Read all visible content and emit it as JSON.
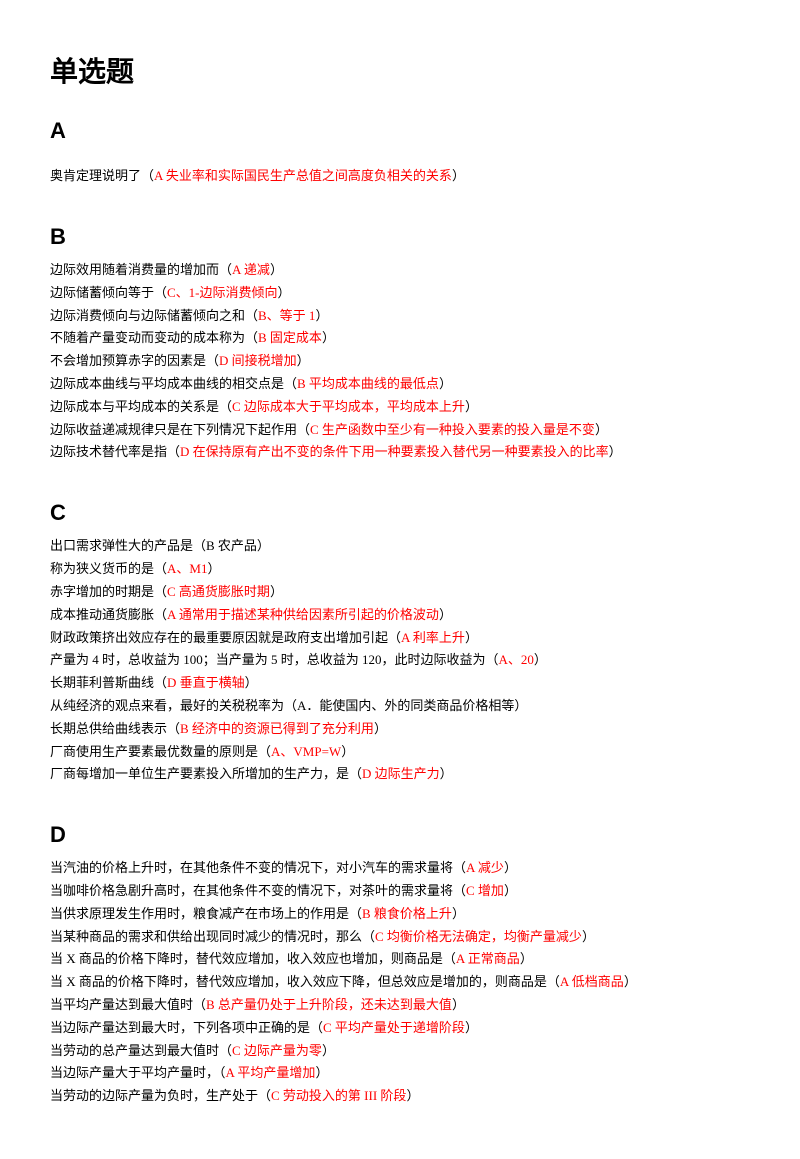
{
  "title": "单选题",
  "sections": {
    "A": {
      "heading": "A",
      "items": [
        {
          "pre": "奥肯定理说明了（",
          "ans": "A 失业率和实际国民生产总值之间高度负相关的关系",
          "post": "）"
        }
      ]
    },
    "B": {
      "heading": "B",
      "items": [
        {
          "pre": "边际效用随着消费量的增加而（",
          "ans": "A 递减",
          "post": "）"
        },
        {
          "pre": "边际储蓄倾向等于（",
          "ans": "C、1-边际消费倾向",
          "post": "）"
        },
        {
          "pre": "边际消费倾向与边际储蓄倾向之和（",
          "ans": "B、等于 1",
          "post": "）"
        },
        {
          "pre": "不随着产量变动而变动的成本称为（",
          "ans": "B 固定成本",
          "post": "）"
        },
        {
          "pre": "不会增加预算赤字的因素是（",
          "ans": "D 间接税增加",
          "post": "）"
        },
        {
          "pre": "边际成本曲线与平均成本曲线的相交点是（",
          "ans": "B 平均成本曲线的最低点",
          "post": "）"
        },
        {
          "pre": "边际成本与平均成本的关系是（",
          "ans": "C 边际成本大于平均成本，平均成本上升",
          "post": "）"
        },
        {
          "pre": "边际收益递减规律只是在下列情况下起作用（",
          "ans": "C 生产函数中至少有一种投入要素的投入量是不变",
          "post": "）"
        },
        {
          "pre": "边际技术替代率是指（",
          "ans": "D 在保持原有产出不变的条件下用一种要素投入替代另一种要素投入的比率",
          "post": "）"
        }
      ]
    },
    "C": {
      "heading": "C",
      "items": [
        {
          "pre": "出口需求弹性大的产品是（B 农产品）",
          "ans": "",
          "post": ""
        },
        {
          "pre": "称为狭义货币的是（",
          "ans": "A、M1",
          "post": "）"
        },
        {
          "pre": "赤字增加的时期是（",
          "ans": "C 高通货膨胀时期",
          "post": "）"
        },
        {
          "pre": "成本推动通货膨胀（",
          "ans": "A 通常用于描述某种供给因素所引起的价格波动",
          "post": "）"
        },
        {
          "pre": "财政政策挤出效应存在的最重要原因就是政府支出增加引起（",
          "ans": "A 利率上升",
          "post": "）"
        },
        {
          "pre": "产量为 4 时，总收益为 100；当产量为 5 时，总收益为 120，此时边际收益为（",
          "ans": "A、20",
          "post": "）"
        },
        {
          "pre": "长期菲利普斯曲线（",
          "ans": "D 垂直于横轴",
          "post": "）"
        },
        {
          "pre": "从纯经济的观点来看，最好的关税税率为（A．能使国内、外的同类商品价格相等）",
          "ans": "",
          "post": ""
        },
        {
          "pre": "长期总供给曲线表示（",
          "ans": "B 经济中的资源已得到了充分利用",
          "post": "）"
        },
        {
          "pre": "厂商使用生产要素最优数量的原则是（",
          "ans": "A、VMP=W",
          "post": "）"
        },
        {
          "pre": "厂商每增加一单位生产要素投入所增加的生产力，是（",
          "ans": "D 边际生产力",
          "post": "）"
        }
      ]
    },
    "D": {
      "heading": "D",
      "items": [
        {
          "pre": "当汽油的价格上升时，在其他条件不变的情况下，对小汽车的需求量将（",
          "ans": "A 减少",
          "post": "）"
        },
        {
          "pre": "当咖啡价格急剧升高时，在其他条件不变的情况下，对茶叶的需求量将（",
          "ans": "C 增加",
          "post": "）"
        },
        {
          "pre": "当供求原理发生作用时，粮食减产在市场上的作用是（",
          "ans": "B 粮食价格上升",
          "post": "）"
        },
        {
          "pre": "当某种商品的需求和供给出现同时减少的情况时，那么（",
          "ans": "C 均衡价格无法确定，均衡产量减少",
          "post": "）"
        },
        {
          "pre": "当 X 商品的价格下降时，替代效应增加，收入效应也增加，则商品是（",
          "ans": "A 正常商品",
          "post": "）"
        },
        {
          "pre": "当 X 商品的价格下降时，替代效应增加，收入效应下降，但总效应是增加的，则商品是（",
          "ans": "A 低档商品",
          "post": "）"
        },
        {
          "pre": "当平均产量达到最大值时（",
          "ans": "B 总产量仍处于上升阶段，还未达到最大值",
          "post": "）"
        },
        {
          "pre": "当边际产量达到最大时，下列各项中正确的是（",
          "ans": "C 平均产量处于递增阶段",
          "post": "）"
        },
        {
          "pre": "当劳动的总产量达到最大值时（",
          "ans": "C 边际产量为零",
          "post": "）"
        },
        {
          "pre": "当边际产量大于平均产量时，（",
          "ans": "A 平均产量增加",
          "post": "）"
        },
        {
          "pre": "当劳动的边际产量为负时，生产处于（",
          "ans": "C 劳动投入的第 III 阶段",
          "post": "）"
        }
      ]
    }
  }
}
